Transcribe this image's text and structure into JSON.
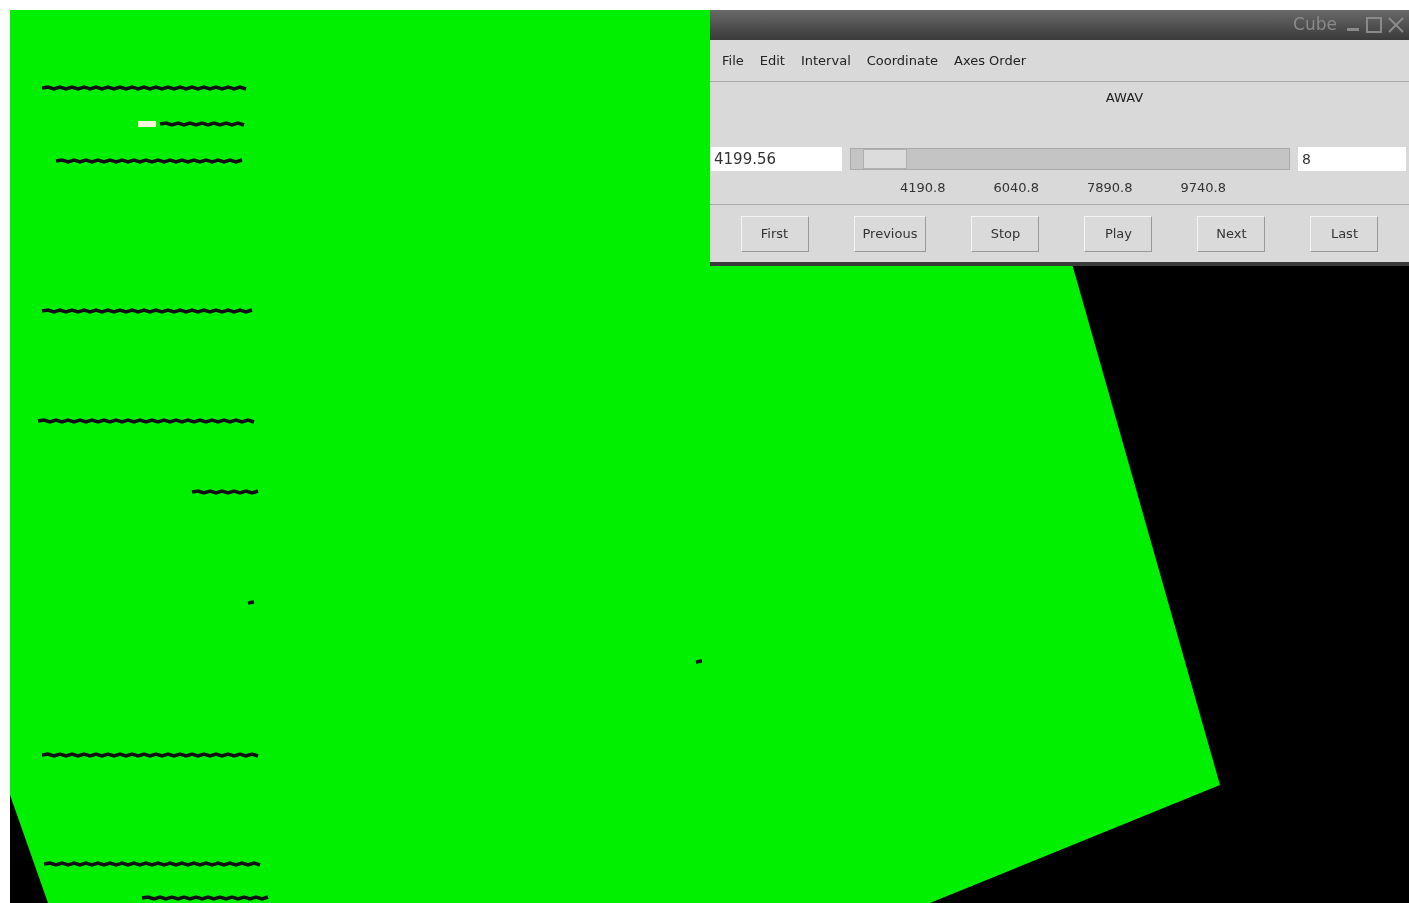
{
  "window": {
    "title": "Cube"
  },
  "menu": [
    "File",
    "Edit",
    "Interval",
    "Coordinate",
    "Axes Order"
  ],
  "axis_label": "AWAV",
  "value_field": {
    "value": "4199.56"
  },
  "slider": {
    "level": 0.03
  },
  "index_field": {
    "value": "8"
  },
  "ticks": [
    "4190.8",
    "6040.8",
    "7890.8",
    "9740.8"
  ],
  "buttons": [
    "First",
    "Previous",
    "Stop",
    "Play",
    "Next",
    "Last"
  ]
}
